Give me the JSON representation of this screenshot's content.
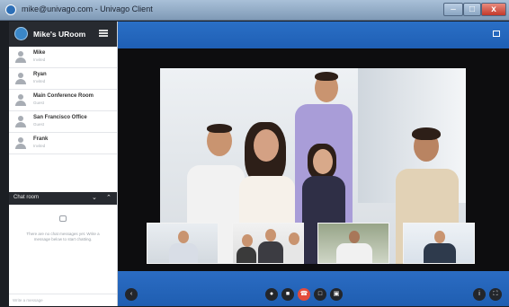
{
  "window": {
    "title": "mike@univago.com - Univago Client",
    "min_label": "–",
    "max_label": "□",
    "close_label": "x"
  },
  "room": {
    "name": "Mike's URoom"
  },
  "contacts": [
    {
      "name": "Mike",
      "status": "Invited"
    },
    {
      "name": "Ryan",
      "status": "Invited"
    },
    {
      "name": "Main Conference Room",
      "status": "Guest"
    },
    {
      "name": "San Francisco Office",
      "status": "Guest"
    },
    {
      "name": "Frank",
      "status": "Invited"
    }
  ],
  "chat": {
    "title": "Chat room",
    "empty_text": "There are no chat messages yet. Write a message below to start chatting.",
    "input_placeholder": "Write a message",
    "collapse_icon": "chevron-down-icon",
    "expand_icon": "chevron-up-icon"
  },
  "controls": {
    "back": "back-icon",
    "mic": "microphone-icon",
    "camera": "camera-icon",
    "hangup": "hang-up-icon",
    "chat": "chat-bubble-icon",
    "share": "screen-share-icon",
    "info": "info-icon",
    "fullscreen": "fullscreen-icon"
  },
  "colors": {
    "accent_blue": "#1f5fb4",
    "hangup_red": "#e34b3c",
    "sidebar_dark": "#272a30"
  }
}
